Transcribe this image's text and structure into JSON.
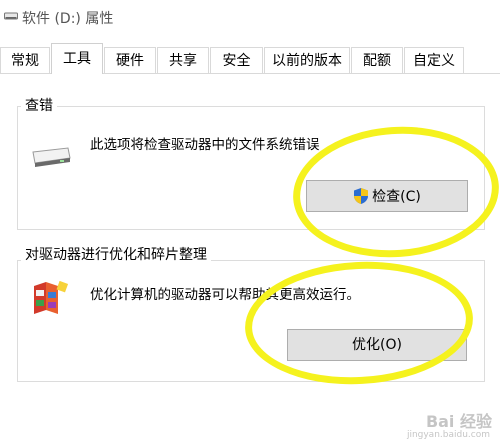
{
  "window": {
    "title": "软件 (D:) 属性",
    "title_icon": "drive-icon"
  },
  "tabs": [
    {
      "label": "常规",
      "active": false
    },
    {
      "label": "工具",
      "active": true
    },
    {
      "label": "硬件",
      "active": false
    },
    {
      "label": "共享",
      "active": false
    },
    {
      "label": "安全",
      "active": false
    },
    {
      "label": "以前的版本",
      "active": false
    },
    {
      "label": "配额",
      "active": false
    },
    {
      "label": "自定义",
      "active": false
    }
  ],
  "error_check": {
    "group_title": "查错",
    "description": "此选项将检查驱动器中的文件系统错误",
    "button_label": "检查(C)",
    "icon": "hard-drive-icon",
    "button_icon": "uac-shield-icon"
  },
  "optimize": {
    "group_title": "对驱动器进行优化和碎片整理",
    "description": "优化计算机的驱动器可以帮助其更高效运行。",
    "button_label": "优化(O)",
    "icon": "defrag-icon"
  },
  "annotation": {
    "color": "#f5f21e"
  },
  "watermark": {
    "text": "Bai 经验",
    "sub": "jingyan.baidu.com"
  }
}
